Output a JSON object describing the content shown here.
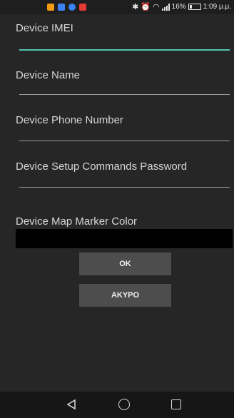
{
  "status_bar": {
    "battery_percent": "16%",
    "time": "1:09 μ.μ.",
    "notification_colors": [
      "#f39c12",
      "#3b82f6",
      "#3b82f6",
      "#e53935"
    ]
  },
  "form": {
    "imei_label": "Device IMEI",
    "imei_value": "",
    "name_label": "Device Name",
    "name_value": "",
    "phone_label": "Device Phone Number",
    "phone_value": "",
    "password_label": "Device Setup Commands Password",
    "password_value": "",
    "color_label": "Device Map Marker Color",
    "color_value": "#000000"
  },
  "buttons": {
    "ok_label": "OK",
    "cancel_label": "AKYPO"
  },
  "colors": {
    "accent": "#4fc3b3",
    "background": "#262626",
    "button": "#4d4d4d"
  }
}
